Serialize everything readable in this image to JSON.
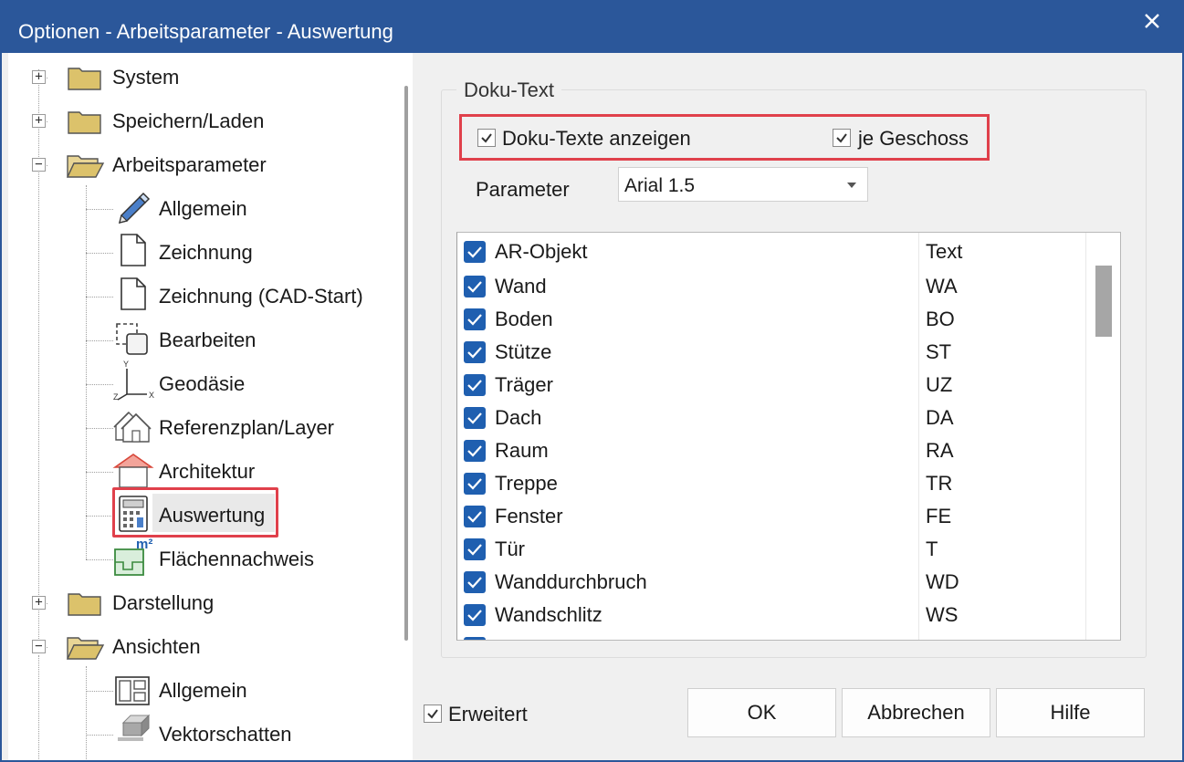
{
  "window": {
    "title": "Optionen - Arbeitsparameter - Auswertung",
    "close_glyph": "✕"
  },
  "tree": {
    "expand_glyph": "+",
    "collapse_glyph": "−",
    "items": [
      {
        "label": "System",
        "icon": "folder-closed-icon",
        "state": "collapsed"
      },
      {
        "label": "Speichern/Laden",
        "icon": "folder-closed-icon",
        "state": "collapsed"
      },
      {
        "label": "Arbeitsparameter",
        "icon": "folder-open-icon",
        "state": "expanded"
      },
      {
        "label": "Allgemein",
        "icon": "pencil-icon"
      },
      {
        "label": "Zeichnung",
        "icon": "document-icon"
      },
      {
        "label": "Zeichnung (CAD-Start)",
        "icon": "document-icon"
      },
      {
        "label": "Bearbeiten",
        "icon": "edit-selection-icon"
      },
      {
        "label": "Geodäsie",
        "icon": "xyz-axes-icon",
        "axis_labels": [
          "Y",
          "Z",
          "X"
        ]
      },
      {
        "label": "Referenzplan/Layer",
        "icon": "house-layers-icon"
      },
      {
        "label": "Architektur",
        "icon": "house-icon"
      },
      {
        "label": "Auswertung",
        "icon": "calculator-icon",
        "selected": true
      },
      {
        "label": "Flächennachweis",
        "icon": "area-m2-icon",
        "badge": "m²"
      },
      {
        "label": "Darstellung",
        "icon": "folder-closed-icon",
        "state": "collapsed"
      },
      {
        "label": "Ansichten",
        "icon": "folder-open-icon",
        "state": "expanded"
      },
      {
        "label": "Allgemein",
        "icon": "layout-icon"
      },
      {
        "label": "Vektorschatten",
        "icon": "vector-shadow-icon"
      }
    ]
  },
  "doku_group": {
    "legend": "Doku-Text",
    "show_doku_texts": {
      "label": "Doku-Texte anzeigen",
      "checked": true
    },
    "per_storey": {
      "label": "je Geschoss",
      "checked": true
    },
    "parameter_label": "Parameter",
    "parameter_value": "Arial 1.5",
    "list": {
      "header": {
        "name": "AR-Objekt",
        "code": "Text"
      },
      "rows": [
        {
          "name": "Wand",
          "code": "WA",
          "checked": true
        },
        {
          "name": "Boden",
          "code": "BO",
          "checked": true
        },
        {
          "name": "Stütze",
          "code": "ST",
          "checked": true
        },
        {
          "name": "Träger",
          "code": "UZ",
          "checked": true
        },
        {
          "name": "Dach",
          "code": "DA",
          "checked": true
        },
        {
          "name": "Raum",
          "code": "RA",
          "checked": true
        },
        {
          "name": "Treppe",
          "code": "TR",
          "checked": true
        },
        {
          "name": "Fenster",
          "code": "FE",
          "checked": true
        },
        {
          "name": "Tür",
          "code": "T",
          "checked": true
        },
        {
          "name": "Wanddurchbruch",
          "code": "WD",
          "checked": true
        },
        {
          "name": "Wandschlitz",
          "code": "WS",
          "checked": true
        }
      ]
    }
  },
  "footer": {
    "extended": {
      "label": "Erweitert",
      "checked": true
    },
    "ok_label": "OK",
    "cancel_label": "Abbrechen",
    "help_label": "Hilfe"
  },
  "colors": {
    "titlebar": "#2b579a",
    "highlight_border": "#e0404b",
    "checkbox_blue": "#1f5fb0",
    "folder_fill": "#dcc26b"
  }
}
